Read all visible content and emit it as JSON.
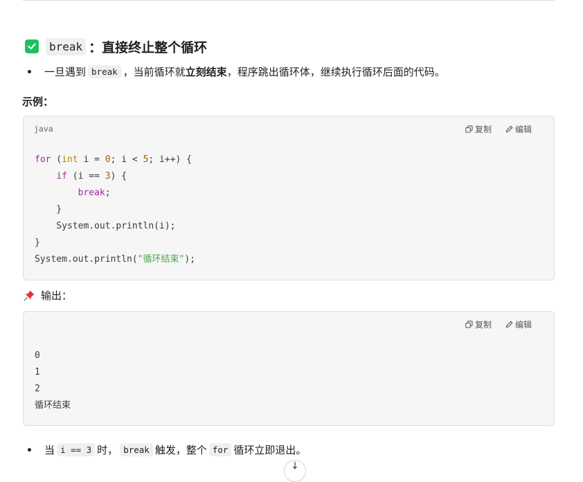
{
  "heading": {
    "keyword": "break",
    "text": "：直接终止整个循环"
  },
  "intro": {
    "prefix": "一旦遇到",
    "code": "break",
    "mid": "，当前循环就",
    "bold": "立刻结束",
    "suffix": "，程序跳出循环体，继续执行循环后面的代码。"
  },
  "example_label": "示例：",
  "code_block": {
    "language": "java",
    "copy_label": "复制",
    "edit_label": "编辑"
  },
  "output_label": "输出：",
  "output_block": {
    "copy_label": "复制",
    "edit_label": "编辑",
    "lines": [
      "0",
      "1",
      "2",
      "循环结束"
    ]
  },
  "summary": {
    "prefix": "当",
    "code1": "i == 3",
    "t1": "时，",
    "code2": "break",
    "t2": "触发，整个",
    "code3": "for",
    "t3": "循环立即退出。"
  },
  "colors": {
    "check": "#1cc15e",
    "keyword": "#a626a4",
    "type": "#c18401",
    "number": "#986801",
    "string": "#50a14f"
  },
  "icons": [
    "checkmark-icon",
    "copy-icon",
    "edit-icon",
    "pushpin-icon",
    "chevron-down-icon"
  ]
}
